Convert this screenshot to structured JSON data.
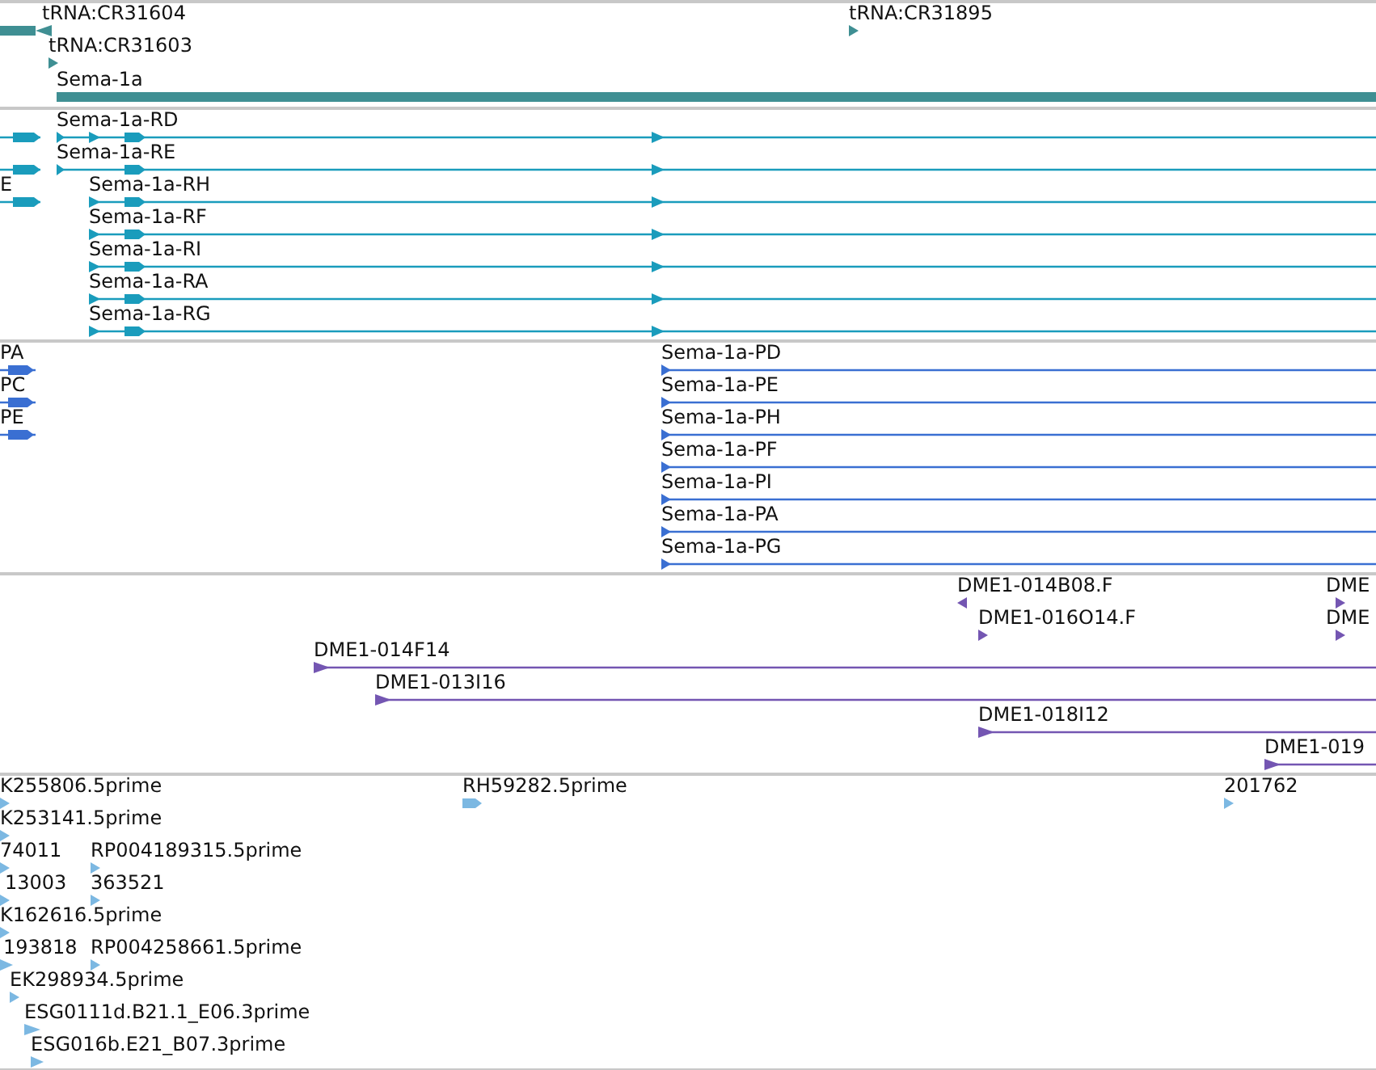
{
  "tracks": [
    {
      "features": [
        {
          "label": "tRNA:CR31604",
          "kind": "trna",
          "reverse": true
        },
        {
          "label": "tRNA:CR31895",
          "kind": "trna",
          "reverse": false
        },
        {
          "label": "tRNA:CR31603",
          "kind": "trna",
          "reverse": false
        },
        {
          "label": "Sema-1a",
          "kind": "gene"
        }
      ]
    },
    {
      "features": [
        {
          "kind": "transcript"
        },
        {
          "label": "Sema-1a-RD",
          "kind": "transcript"
        },
        {
          "kind": "transcript"
        },
        {
          "label": "Sema-1a-RE",
          "kind": "transcript"
        },
        {
          "label": "E",
          "kind": "transcript"
        },
        {
          "label": "Sema-1a-RH",
          "kind": "transcript"
        },
        {
          "label": "Sema-1a-RF",
          "kind": "transcript"
        },
        {
          "label": "Sema-1a-RI",
          "kind": "transcript"
        },
        {
          "label": "Sema-1a-RA",
          "kind": "transcript"
        },
        {
          "label": "Sema-1a-RG",
          "kind": "transcript"
        }
      ]
    },
    {
      "features": [
        {
          "label": "PA",
          "kind": "protein"
        },
        {
          "label": "PC",
          "kind": "protein"
        },
        {
          "label": "PE",
          "kind": "protein"
        },
        {
          "label": "Sema-1a-PD",
          "kind": "protein"
        },
        {
          "label": "Sema-1a-PE",
          "kind": "protein"
        },
        {
          "label": "Sema-1a-PH",
          "kind": "protein"
        },
        {
          "label": "Sema-1a-PF",
          "kind": "protein"
        },
        {
          "label": "Sema-1a-PI",
          "kind": "protein"
        },
        {
          "label": "Sema-1a-PA",
          "kind": "protein"
        },
        {
          "label": "Sema-1a-PG",
          "kind": "protein"
        }
      ]
    },
    {
      "features": [
        {
          "label": "DME1-014B08.F",
          "kind": "marker",
          "reverse": true
        },
        {
          "label": "DME",
          "kind": "marker",
          "reverse": false
        },
        {
          "label": "DME1-016O14.F",
          "kind": "marker",
          "reverse": false
        },
        {
          "label": "DME",
          "kind": "marker",
          "reverse": false
        },
        {
          "label": "DME1-014F14",
          "kind": "clone",
          "reverse": false
        },
        {
          "label": "DME1-013I16",
          "kind": "clone",
          "reverse": false
        },
        {
          "label": "DME1-018I12",
          "kind": "clone",
          "reverse": false
        },
        {
          "label": "DME1-019",
          "kind": "clone",
          "reverse": false
        }
      ]
    },
    {
      "features": [
        {
          "label": "K255806.5prime",
          "kind": "est"
        },
        {
          "label": "RH59282.5prime",
          "kind": "est"
        },
        {
          "label": "201762",
          "kind": "est"
        },
        {
          "label": "K253141.5prime",
          "kind": "est"
        },
        {
          "label": "74011",
          "kind": "est"
        },
        {
          "label": "RP004189315.5prime",
          "kind": "est"
        },
        {
          "label": "13003",
          "kind": "est"
        },
        {
          "label": "363521",
          "kind": "est"
        },
        {
          "label": "K162616.5prime",
          "kind": "est"
        },
        {
          "label": "193818",
          "kind": "est"
        },
        {
          "label": "RP004258661.5prime",
          "kind": "est"
        },
        {
          "label": "EK298934.5prime",
          "kind": "est"
        },
        {
          "label": "ESG0111d.B21.1_E06.3prime",
          "kind": "est"
        },
        {
          "label": "ESG016b.E21_B07.3prime",
          "kind": "est"
        }
      ]
    }
  ]
}
